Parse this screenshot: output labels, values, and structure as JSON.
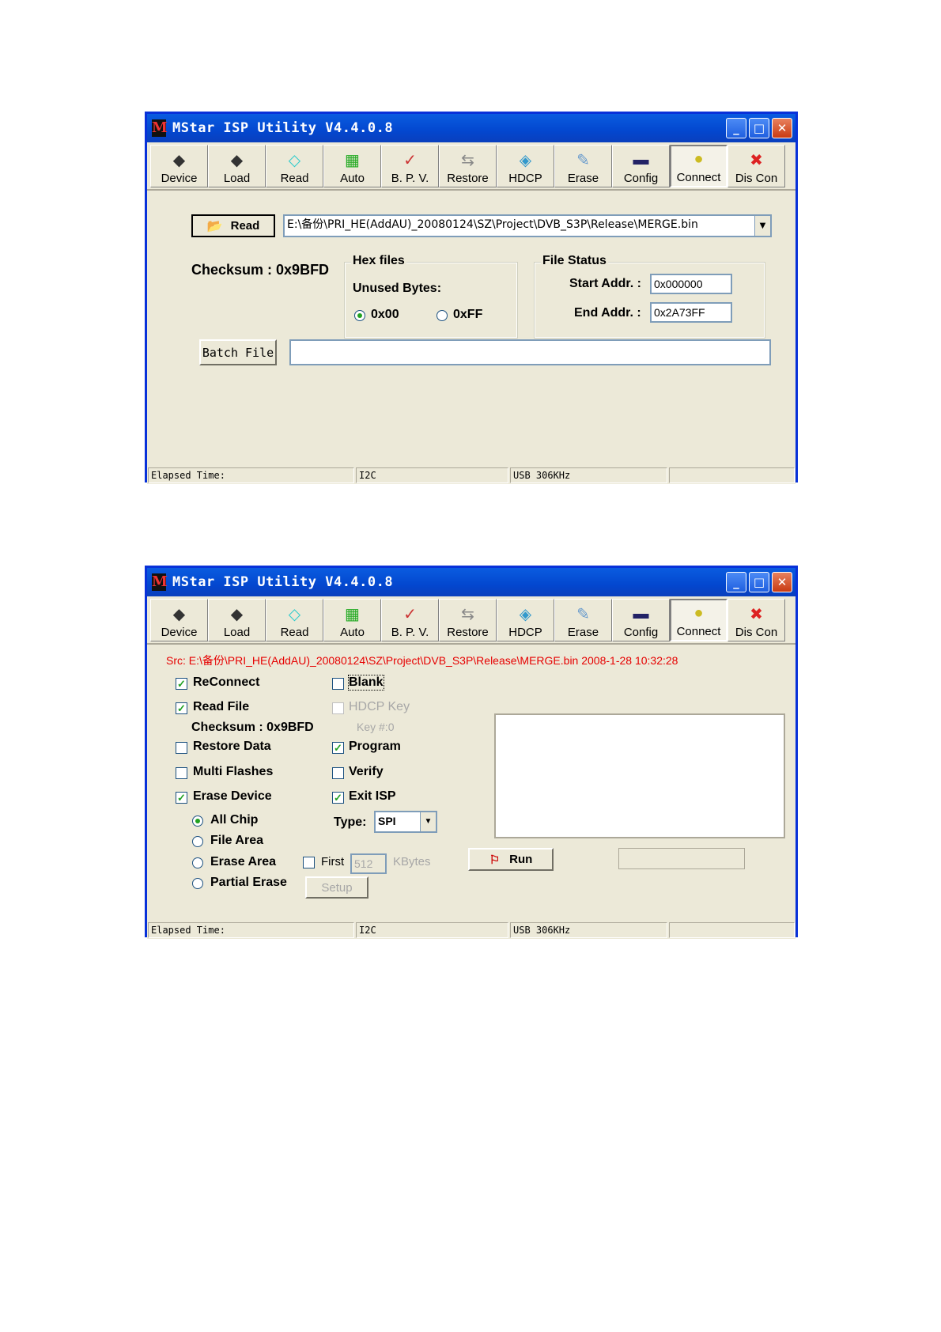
{
  "title": "MStar ISP Utility V4.4.0.8",
  "toolbar": [
    "Device",
    "Load",
    "Read",
    "Auto",
    "B. P. V.",
    "Restore",
    "HDCP",
    "Erase",
    "Config",
    "Connect",
    "Dis Con"
  ],
  "window_buttons": {
    "minimize": "_",
    "maximize": "□",
    "close": "✕"
  },
  "status": {
    "elapsed": "Elapsed Time:",
    "bus": "I2C",
    "usb": "USB   306KHz"
  },
  "read_window": {
    "read_button": "Read",
    "file_path": "E:\\备份\\PRI_HE(AddAU)_20080124\\SZ\\Project\\DVB_S3P\\Release\\MERGE.bin",
    "checksum": "Checksum : 0x9BFD",
    "hex_files": {
      "title": "Hex files",
      "unused_bytes": "Unused Bytes:",
      "opt1": "0x00",
      "opt2": "0xFF"
    },
    "file_status": {
      "title": "File Status",
      "start_label": "Start Addr. :",
      "start_value": "0x000000",
      "end_label": "End Addr. :",
      "end_value": "0x2A73FF"
    },
    "batch_button": "Batch File",
    "batch_value": ""
  },
  "auto_window": {
    "src": "Src: E:\\备份\\PRI_HE(AddAU)_20080124\\SZ\\Project\\DVB_S3P\\Release\\MERGE.bin 2008-1-28 10:32:28",
    "reconnect": "ReConnect",
    "read_file": "Read File",
    "checksum": "Checksum : 0x9BFD",
    "restore_data": "Restore Data",
    "multi_flashes": "Multi Flashes",
    "erase_device": "Erase Device",
    "all_chip": "All Chip",
    "file_area": "File Area",
    "erase_area": "Erase Area",
    "partial_erase": "Partial Erase",
    "blank": "Blank",
    "hdcp_key": "HDCP Key",
    "key_no": "Key #:0",
    "program": "Program",
    "verify": "Verify",
    "exit_isp": "Exit ISP",
    "type_label": "Type:",
    "type_value": "SPI",
    "first": "First",
    "first_value": "512",
    "kbytes": "KBytes",
    "setup": "Setup",
    "run": "Run"
  },
  "icons": [
    "chip-icon",
    "chip-load-icon",
    "diamond-icon",
    "auto-icon",
    "check-icon",
    "restore-icon",
    "hdcp-icon",
    "erase-icon",
    "config-icon",
    "connect-icon",
    "disconnect-icon"
  ],
  "colors": {
    "title_bar": "#0347cf",
    "face": "#ece9d8",
    "src_text": "#e60000"
  }
}
